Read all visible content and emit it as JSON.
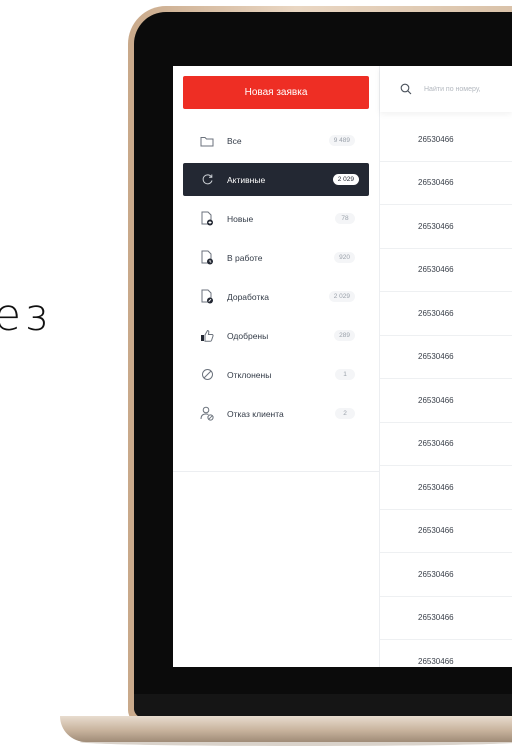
{
  "background_text": "ез",
  "sidebar": {
    "new_button_label": "Новая заявка",
    "items": [
      {
        "label": "Все",
        "count": "9 489",
        "icon": "folder-icon"
      },
      {
        "label": "Активные",
        "count": "2 029",
        "icon": "refresh-icon",
        "active": true
      },
      {
        "label": "Новые",
        "count": "78",
        "icon": "new-file-icon"
      },
      {
        "label": "В работе",
        "count": "920",
        "icon": "in-progress-file-icon"
      },
      {
        "label": "Доработка",
        "count": "2 029",
        "icon": "revision-file-icon"
      },
      {
        "label": "Одобрены",
        "count": "289",
        "icon": "thumbs-up-icon"
      },
      {
        "label": "Отклонены",
        "count": "1",
        "icon": "blocked-icon"
      },
      {
        "label": "Отказ клиента",
        "count": "2",
        "icon": "client-refusal-icon"
      }
    ]
  },
  "search": {
    "placeholder": "Найти по номеру, ",
    "icon": "search-icon"
  },
  "table": {
    "rows": [
      "26530466",
      "26530466",
      "26530466",
      "26530466",
      "26530466",
      "26530466",
      "26530466",
      "26530466",
      "26530466",
      "26530466",
      "26530466",
      "26530466",
      "26530466"
    ]
  },
  "colors": {
    "accent": "#ee2e24",
    "active_item_bg": "#232833",
    "laptop_gold": "#d7bfa5"
  }
}
